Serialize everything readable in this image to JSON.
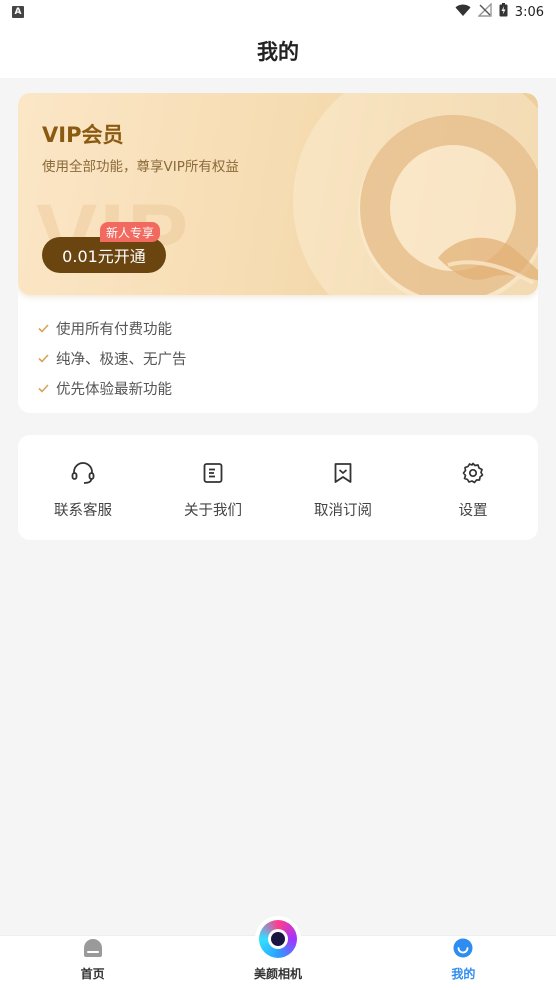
{
  "status_bar": {
    "time": "3:06",
    "notification_badge": "A"
  },
  "header": {
    "title": "我的"
  },
  "vip": {
    "title": "VIP会员",
    "subtitle": "使用全部功能，尊享VIP所有权益",
    "watermark": "VIP",
    "button_label": "0.01元开通",
    "tag": "新人专享",
    "benefits": [
      "使用所有付费功能",
      "纯净、极速、无广告",
      "优先体验最新功能"
    ],
    "colors": {
      "title": "#8b5a12",
      "button": "#6b4510",
      "tag": "#f26a5f",
      "check": "#d9a25a"
    }
  },
  "menu": {
    "items": [
      {
        "label": "联系客服",
        "icon": "headset-icon"
      },
      {
        "label": "关于我们",
        "icon": "document-icon"
      },
      {
        "label": "取消订阅",
        "icon": "bookmark-icon"
      },
      {
        "label": "设置",
        "icon": "gear-icon"
      }
    ]
  },
  "tab_bar": {
    "tabs": [
      {
        "label": "首页",
        "icon": "home-icon",
        "active": false
      },
      {
        "label": "美颜相机",
        "icon": "camera-icon",
        "active": false
      },
      {
        "label": "我的",
        "icon": "profile-smile-icon",
        "active": true
      }
    ],
    "active_color": "#2f8cf0"
  }
}
